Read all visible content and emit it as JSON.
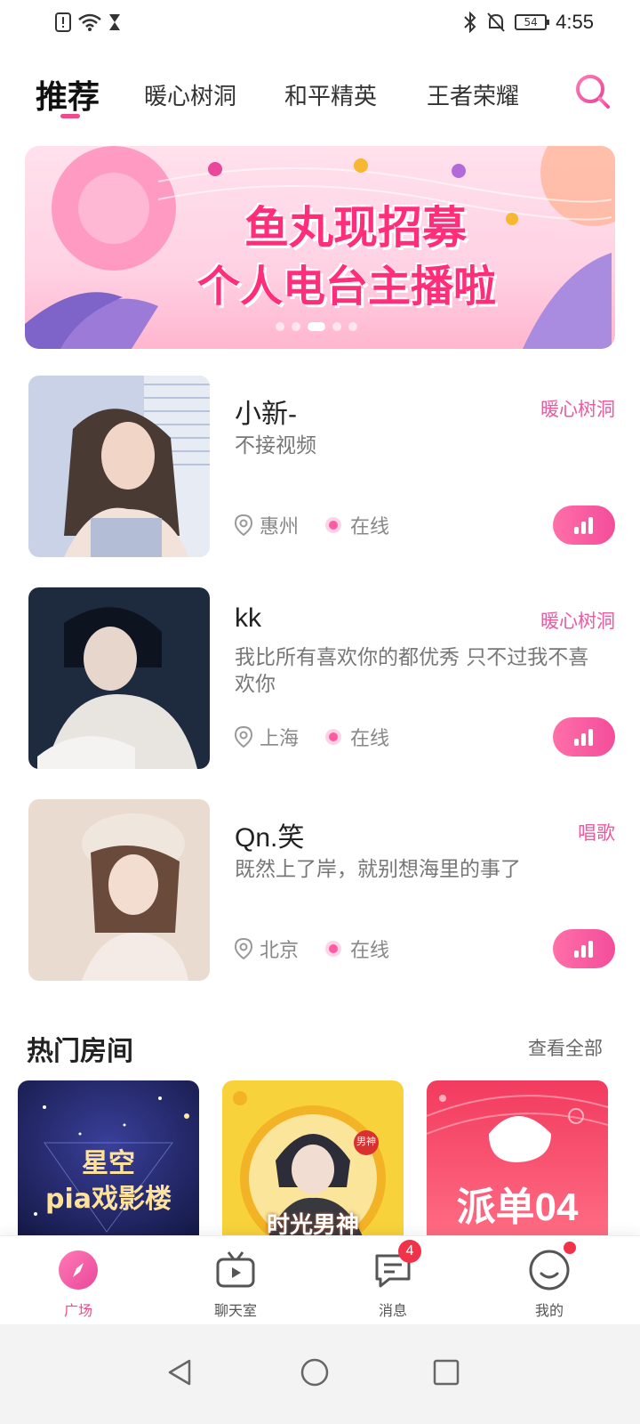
{
  "status_bar": {
    "time": "4:55",
    "battery": "54"
  },
  "tabs": [
    {
      "label": "推荐",
      "active": true
    },
    {
      "label": "暖心树洞",
      "active": false
    },
    {
      "label": "和平精英",
      "active": false
    },
    {
      "label": "王者荣耀",
      "active": false
    }
  ],
  "banner": {
    "line1": "鱼丸现招募",
    "line2": "个人电台主播啦"
  },
  "users": [
    {
      "name": "小新-",
      "tag": "暖心树洞",
      "bio": "不接视频",
      "location": "惠州",
      "status": "在线"
    },
    {
      "name": " kk",
      "tag": "暖心树洞",
      "bio": "我比所有喜欢你的都优秀 只不过我不喜欢你",
      "location": "上海",
      "status": "在线"
    },
    {
      "name": "Qn.笑",
      "tag": "唱歌",
      "bio": "既然上了岸，就别想海里的事了",
      "location": "北京",
      "status": "在线"
    }
  ],
  "hot_rooms": {
    "title": "热门房间",
    "view_all": "查看全部",
    "rooms": [
      {
        "line1": "星空",
        "line2": "pia戏影楼"
      },
      {
        "line1": "时光男神",
        "badge": "男神"
      },
      {
        "line1": "派单04"
      }
    ]
  },
  "bottom_nav": [
    {
      "label": "广场",
      "icon": "compass-icon",
      "active": true
    },
    {
      "label": "聊天室",
      "icon": "tv-icon",
      "active": false
    },
    {
      "label": "消息",
      "icon": "message-icon",
      "badge": "4",
      "active": false
    },
    {
      "label": "我的",
      "icon": "smile-icon",
      "active": false
    }
  ],
  "colors": {
    "accent": "#f04a8a",
    "tag": "#ee5aa0",
    "badge": "#f0334b"
  }
}
